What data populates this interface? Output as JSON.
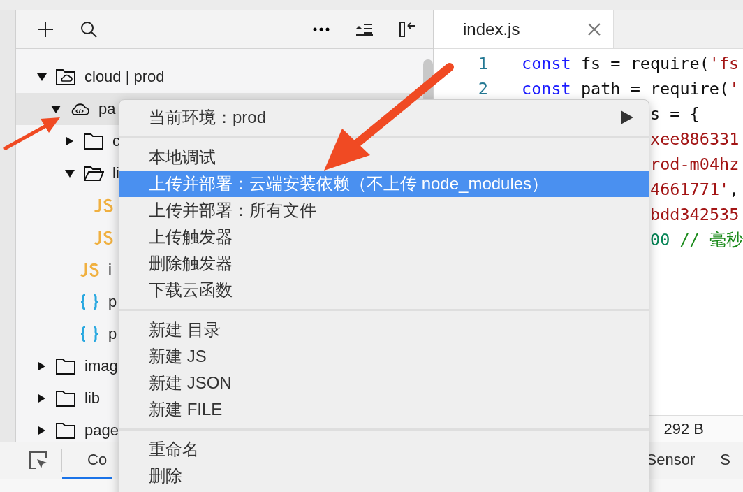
{
  "tree": [
    {
      "label": "cloud | prod",
      "kind": "cloud-folder",
      "expanded": true,
      "selected": false,
      "children": [
        {
          "label": "pa",
          "kind": "cloud-function",
          "expanded": true,
          "selected": true,
          "children": [
            {
              "label": "c",
              "kind": "folder",
              "expanded": false,
              "selected": false
            },
            {
              "label": "li",
              "kind": "folder",
              "expanded": true,
              "selected": false,
              "children": [
                {
                  "kind": "js",
                  "selected": false
                },
                {
                  "kind": "js",
                  "selected": false
                }
              ]
            },
            {
              "label": "i",
              "kind": "js",
              "selected": false
            },
            {
              "label": "p",
              "kind": "json",
              "selected": false
            },
            {
              "label": "p",
              "kind": "json",
              "selected": false
            }
          ]
        }
      ]
    },
    {
      "label": "imag",
      "kind": "folder",
      "expanded": false,
      "selected": false
    },
    {
      "label": "lib",
      "kind": "folder",
      "expanded": false,
      "selected": false
    },
    {
      "label": "page",
      "kind": "folder",
      "expanded": false,
      "selected": false
    }
  ],
  "editor": {
    "tab": {
      "title": "index.js"
    },
    "lines": [
      {
        "number": "1",
        "tokens": [
          {
            "kind": "keyword",
            "text": "const"
          },
          {
            "kind": "plain",
            "text": " fs = require("
          },
          {
            "kind": "string",
            "text": "'fs"
          }
        ]
      },
      {
        "number": "2",
        "tokens": [
          {
            "kind": "keyword",
            "text": "const"
          },
          {
            "kind": "plain",
            "text": " path = require("
          },
          {
            "kind": "string",
            "text": "'"
          }
        ]
      },
      {
        "tokens": [
          {
            "kind": "plain",
            "text": "s = {"
          }
        ]
      },
      {
        "tokens": [
          {
            "kind": "string",
            "text": "xee886331"
          }
        ]
      },
      {
        "tokens": [
          {
            "kind": "string",
            "text": "rod-m04hz"
          }
        ]
      },
      {
        "tokens": [
          {
            "kind": "string",
            "text": "4661771'"
          },
          {
            "kind": "plain",
            "text": ","
          }
        ]
      },
      {
        "tokens": [
          {
            "kind": "string",
            "text": "bdd342535"
          }
        ]
      },
      {
        "tokens": [
          {
            "kind": "number",
            "text": "00"
          },
          {
            "kind": "comment",
            "text": " // 毫秒"
          }
        ]
      }
    ],
    "status": {
      "size": "292 B"
    }
  },
  "devtools": {
    "tabs": [
      {
        "label": "Co",
        "selected": true
      },
      {
        "label": "Sensor",
        "selected": false
      },
      {
        "label": "S",
        "selected": false
      }
    ]
  },
  "context_menu": {
    "sections": [
      [
        {
          "label": "当前环境：prod",
          "submenu": true,
          "selected": false
        }
      ],
      [
        {
          "label": "本地调试",
          "selected": false
        },
        {
          "label": "上传并部署：云端安装依赖（不上传 node_modules）",
          "selected": true
        },
        {
          "label": "上传并部署：所有文件",
          "selected": false
        },
        {
          "label": "上传触发器",
          "selected": false
        },
        {
          "label": "删除触发器",
          "selected": false
        },
        {
          "label": "下载云函数",
          "selected": false
        }
      ],
      [
        {
          "label": "新建 目录",
          "selected": false
        },
        {
          "label": "新建 JS",
          "selected": false
        },
        {
          "label": "新建 JSON",
          "selected": false
        },
        {
          "label": "新建 FILE",
          "selected": false
        }
      ],
      [
        {
          "label": "重命名",
          "selected": false
        },
        {
          "label": "删除",
          "selected": false
        }
      ]
    ]
  }
}
